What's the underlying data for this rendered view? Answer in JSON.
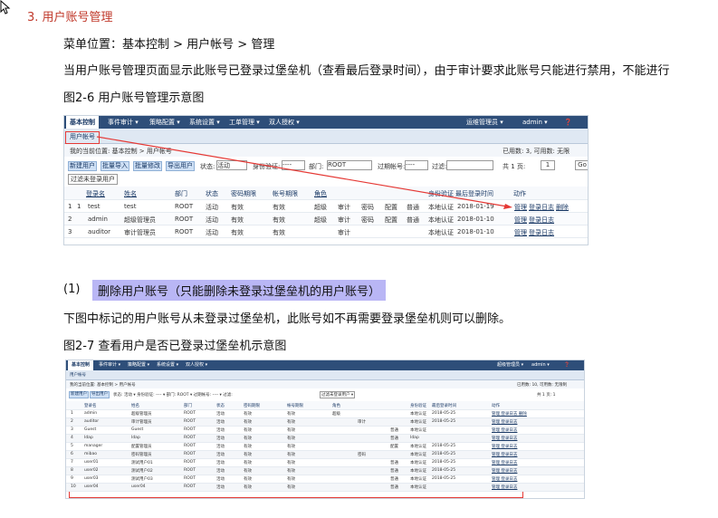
{
  "section_title": "3. 用户账号管理",
  "menu_path": "菜单位置：基本控制 > 用户帐号 > 管理",
  "intro_text": "当用户账号管理页面显示此账号已登录过堡垒机（查看最后登录时间），由于审计要求此账号只能进行禁用，不能进行",
  "figure1_caption": "图2-6 用户账号管理示意图",
  "step1_number": "(1)",
  "step1_title": "删除用户账号（只能删除未登录过堡垒机的用户账号）",
  "step1_text": "下图中标记的用户账号从未登录过堡垒机，此账号如不再需要登录堡垒机则可以删除。",
  "figure2_caption": "图2-7 查看用户是否已登录过堡垒机示意图",
  "shot1": {
    "nav": [
      "基本控制",
      "事件审计 ▾",
      "策略配置 ▾",
      "系统设置 ▾",
      "工单管理 ▾",
      "双人授权 ▾"
    ],
    "nav_right": [
      "运维管理员 ▾",
      "admin ▾"
    ],
    "tab": "用户帐号",
    "breadcrumb": "我的当前位置: 基本控制 > 用户帐号",
    "count_text": "已用数: 3, 可用数: 无限",
    "buttons": [
      "新建用户",
      "批量导入",
      "批量修改",
      "导出用户"
    ],
    "filter_status_label": "状态:",
    "filter_status_value": "活动",
    "filter_auth_label": "身份验证:",
    "filter_auth_value": "----",
    "filter_dept_label": "部门:",
    "filter_dept_value": "ROOT",
    "filter_acct_label": "过期帐号:",
    "filter_acct_value": "----",
    "filter_search_label": "过滤:",
    "pager": "共 1 页:",
    "page_num": "1",
    "go_label": "Go",
    "filter_unlogged": "过滤未登录用户",
    "headers": [
      "登录名",
      "姓名",
      "部门",
      "状态",
      "密码期限",
      "帐号期限",
      "角色",
      "",
      "",
      "",
      "",
      "身份验证",
      "最后登录时间",
      "动作"
    ],
    "rows": [
      {
        "idx": "1",
        "chk": "1",
        "login": "test",
        "name": "test",
        "dept": "ROOT",
        "status": "活动",
        "pwd": "有效",
        "acct": "有效",
        "role": "超级",
        "c1": "审计",
        "c2": "密码",
        "c3": "配置",
        "c4": "普通",
        "auth": "本地认证",
        "last": "2018-01-19",
        "actions": [
          "管理",
          "登录日志",
          "删除"
        ]
      },
      {
        "idx": "2",
        "chk": "",
        "login": "admin",
        "name": "超级管理员",
        "dept": "ROOT",
        "status": "活动",
        "pwd": "有效",
        "acct": "有效",
        "role": "超级",
        "c1": "审计",
        "c2": "密码",
        "c3": "配置",
        "c4": "普通",
        "auth": "本地认证",
        "last": "2018-01-10",
        "actions": [
          "管理",
          "登录日志"
        ]
      },
      {
        "idx": "3",
        "chk": "",
        "login": "auditor",
        "name": "审计管理员",
        "dept": "ROOT",
        "status": "活动",
        "pwd": "有效",
        "acct": "有效",
        "role": "",
        "c1": "审计",
        "c2": "",
        "c3": "",
        "c4": "",
        "auth": "本地认证",
        "last": "2018-01-10",
        "actions": [
          "管理",
          "登录日志"
        ]
      }
    ]
  },
  "shot2": {
    "nav": [
      "基本控制",
      "事件审计 ▾",
      "策略配置 ▾",
      "系统设置 ▾",
      "双人授权 ▾"
    ],
    "nav_right": [
      "超级管理员 ▾",
      "admin ▾"
    ],
    "tab": "用户帐号",
    "breadcrumb": "我的当前位置: 基本控制 > 用户帐号",
    "count_text": "已用数: 10, 可用数: 无限制",
    "buttons": [
      "新建用户",
      "导出用户"
    ],
    "filter_text": "状态: 活动 ▾  身份验证: ---- ▾  部门: ROOT ▾  过期帐号: ---- ▾  过滤:",
    "filter_unlogged": "过滤未登录用户 ▾",
    "pager": "共 1 页: 1",
    "headers": [
      "登录名",
      "姓名",
      "部门",
      "状态",
      "密码期限",
      "帐号期限",
      "角色",
      "",
      "身份验证",
      "最后登录时间",
      "动作"
    ],
    "rows": [
      {
        "idx": "1",
        "login": "admin",
        "name": "超级管理员",
        "dept": "ROOT",
        "status": "活动",
        "pwd": "有效",
        "acct": "有效",
        "role": "超级",
        "r2": "",
        "r3": "",
        "auth": "本地认证",
        "last": "2018-05-25",
        "actions": "管理 登录日志 删除"
      },
      {
        "idx": "2",
        "login": "auditor",
        "name": "审计管理员",
        "dept": "ROOT",
        "status": "活动",
        "pwd": "有效",
        "acct": "有效",
        "role": "",
        "r2": "审计",
        "r3": "",
        "auth": "本地认证",
        "last": "2018-05-25",
        "actions": "管理 登录日志"
      },
      {
        "idx": "3",
        "login": "Guest",
        "name": "Guest",
        "dept": "ROOT",
        "status": "活动",
        "pwd": "有效",
        "acct": "有效",
        "role": "",
        "r2": "",
        "r3": "普通",
        "auth": "本地认证",
        "last": "",
        "actions": "管理 登录日志"
      },
      {
        "idx": "4",
        "login": "Idap",
        "name": "Idap",
        "dept": "ROOT",
        "status": "活动",
        "pwd": "有效",
        "acct": "有效",
        "role": "",
        "r2": "",
        "r3": "普通",
        "auth": "Idap",
        "last": "",
        "actions": "管理 登录日志"
      },
      {
        "idx": "5",
        "login": "manager",
        "name": "配置管理员",
        "dept": "ROOT",
        "status": "活动",
        "pwd": "有效",
        "acct": "有效",
        "role": "",
        "r2": "",
        "r3": "配置",
        "auth": "本地认证",
        "last": "2018-05-25",
        "actions": "管理 登录日志"
      },
      {
        "idx": "6",
        "login": "mibao",
        "name": "密码管理员",
        "dept": "ROOT",
        "status": "活动",
        "pwd": "有效",
        "acct": "有效",
        "role": "",
        "r2": "密码",
        "r3": "",
        "auth": "本地认证",
        "last": "2018-05-25",
        "actions": "管理 登录日志"
      },
      {
        "idx": "7",
        "login": "user01",
        "name": "测试用户01",
        "dept": "ROOT",
        "status": "活动",
        "pwd": "有效",
        "acct": "有效",
        "role": "",
        "r2": "",
        "r3": "普通",
        "auth": "本地认证",
        "last": "2018-05-25",
        "actions": "管理 登录日志"
      },
      {
        "idx": "8",
        "login": "user02",
        "name": "测试用户02",
        "dept": "ROOT",
        "status": "活动",
        "pwd": "有效",
        "acct": "有效",
        "role": "",
        "r2": "",
        "r3": "普通",
        "auth": "本地认证",
        "last": "2018-05-25",
        "actions": "管理 登录日志"
      },
      {
        "idx": "9",
        "login": "user03",
        "name": "测试用户03",
        "dept": "ROOT",
        "status": "活动",
        "pwd": "有效",
        "acct": "有效",
        "role": "",
        "r2": "",
        "r3": "普通",
        "auth": "本地认证",
        "last": "2018-05-25",
        "actions": "管理 登录日志"
      },
      {
        "idx": "10",
        "login": "user04",
        "name": "user04",
        "dept": "ROOT",
        "status": "活动",
        "pwd": "有效",
        "acct": "有效",
        "role": "",
        "r2": "",
        "r3": "普通",
        "auth": "本地认证",
        "last": "",
        "actions": "管理 登录日志"
      }
    ]
  }
}
